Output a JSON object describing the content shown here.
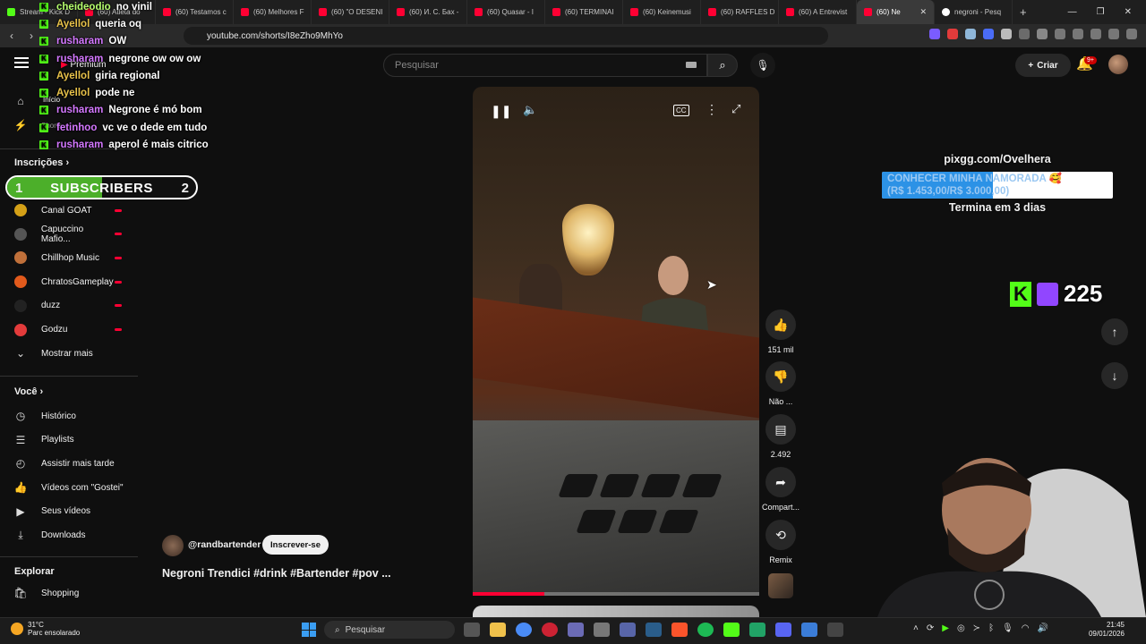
{
  "browser": {
    "tabs": [
      {
        "label": "Stream - Kick D",
        "kind": "kick",
        "active": false
      },
      {
        "label": "(60) Atleta do",
        "kind": "yt",
        "active": false
      },
      {
        "label": "(60) Testamos c",
        "kind": "yt",
        "active": false
      },
      {
        "label": "(60) Melhores F",
        "kind": "yt",
        "active": false
      },
      {
        "label": "(60) \"O DESENI",
        "kind": "yt",
        "active": false
      },
      {
        "label": "(60) И. С. Бах -",
        "kind": "yt",
        "active": false
      },
      {
        "label": "(60) Quasar - I",
        "kind": "yt",
        "active": false
      },
      {
        "label": "(60) TERMINAI",
        "kind": "yt",
        "active": false
      },
      {
        "label": "(60) Keinemusi",
        "kind": "yt",
        "active": false
      },
      {
        "label": "(60) RAFFLES D",
        "kind": "yt",
        "active": false
      },
      {
        "label": "(60) A Entrevist",
        "kind": "yt",
        "active": false
      },
      {
        "label": "(60) Ne",
        "kind": "yt",
        "active": true
      },
      {
        "label": "negroni - Pesq",
        "kind": "google",
        "active": false
      }
    ],
    "new_tab": "+",
    "url": "youtube.com/shorts/I8eZho9MhYo"
  },
  "header": {
    "search_placeholder": "Pesquisar",
    "create_label": "Criar",
    "notifications_badge": "9+",
    "premium_label": "Premium"
  },
  "sidebar": {
    "home_label": "Início",
    "shorts_label": "Shorts",
    "subscriptions_title": "Inscrições",
    "subscriptions": [
      {
        "label": "Canal GOAT",
        "color": "#d4a017",
        "live": true
      },
      {
        "label": "Capuccino Mafio...",
        "color": "#555555",
        "live": true
      },
      {
        "label": "Chillhop Music",
        "color": "#c0703a",
        "live": true
      },
      {
        "label": "ChratosGameplay",
        "color": "#e25a1c",
        "live": true
      },
      {
        "label": "duzz",
        "color": "#222222",
        "live": true
      },
      {
        "label": "Godzu",
        "color": "#e33b3b",
        "live": true
      }
    ],
    "show_more": "Mostrar mais",
    "you_title": "Você",
    "you_items": [
      {
        "label": "Histórico",
        "icon": "history-icon",
        "glyph": "◷"
      },
      {
        "label": "Playlists",
        "icon": "playlist-icon",
        "glyph": "☰"
      },
      {
        "label": "Assistir mais tarde",
        "icon": "clock-icon",
        "glyph": "◴"
      },
      {
        "label": "Vídeos com \"Gostei\"",
        "icon": "like-icon",
        "glyph": "👍"
      },
      {
        "label": "Seus vídeos",
        "icon": "video-icon",
        "glyph": "▶"
      },
      {
        "label": "Downloads",
        "icon": "download-icon",
        "glyph": "⤓"
      }
    ],
    "explore_title": "Explorar",
    "explore_items": [
      {
        "label": "Shopping",
        "icon": "shopping-icon",
        "glyph": "🛍"
      }
    ]
  },
  "chat": [
    {
      "user": "cheideodio",
      "color": "#b6ff6e",
      "msg": "no vinil"
    },
    {
      "user": "Ayellol",
      "color": "#e8c24a",
      "msg": "queria oq"
    },
    {
      "user": "rusharam",
      "color": "#d478ff",
      "msg": "OW"
    },
    {
      "user": "rusharam",
      "color": "#d478ff",
      "msg": "negrone ow ow ow"
    },
    {
      "user": "Ayellol",
      "color": "#e8c24a",
      "msg": "giria regional"
    },
    {
      "user": "Ayellol",
      "color": "#e8c24a",
      "msg": "pode ne"
    },
    {
      "user": "rusharam",
      "color": "#d478ff",
      "msg": "Negrone é mó bom"
    },
    {
      "user": "fetinhoo",
      "color": "#d478ff",
      "msg": "vc ve o dede em tudo"
    },
    {
      "user": "rusharam",
      "color": "#d478ff",
      "msg": "aperol é mais citrico"
    }
  ],
  "subscriber_goal": {
    "current": "1",
    "label": "SUBSCRIBERS",
    "target": "2",
    "progress": 0.5
  },
  "video": {
    "channel": "@randbartender",
    "subscribe_label": "Inscrever-se",
    "title": "Negroni Trendici #drink #Bartender #pov ...",
    "progress": 0.25,
    "likes": "151 mil",
    "dislike_label": "Não ...",
    "comments": "2.492",
    "share_label": "Compart...",
    "remix_label": "Remix"
  },
  "donation_goal": {
    "site": "pixgg.com/Ovelhera",
    "text_line1": "CONHECER MINHA NAMORADA 🥰",
    "text_line2": "(R$ 1.453,00/R$ 3.000,00)",
    "progress": 0.48,
    "ends": "Termina em 3 dias"
  },
  "viewers": "225",
  "taskbar": {
    "weather_temp": "31°C",
    "weather_desc": "Parc ensolarado",
    "search_label": "Pesquisar",
    "time": "21:45",
    "date": "09/01/2026"
  }
}
